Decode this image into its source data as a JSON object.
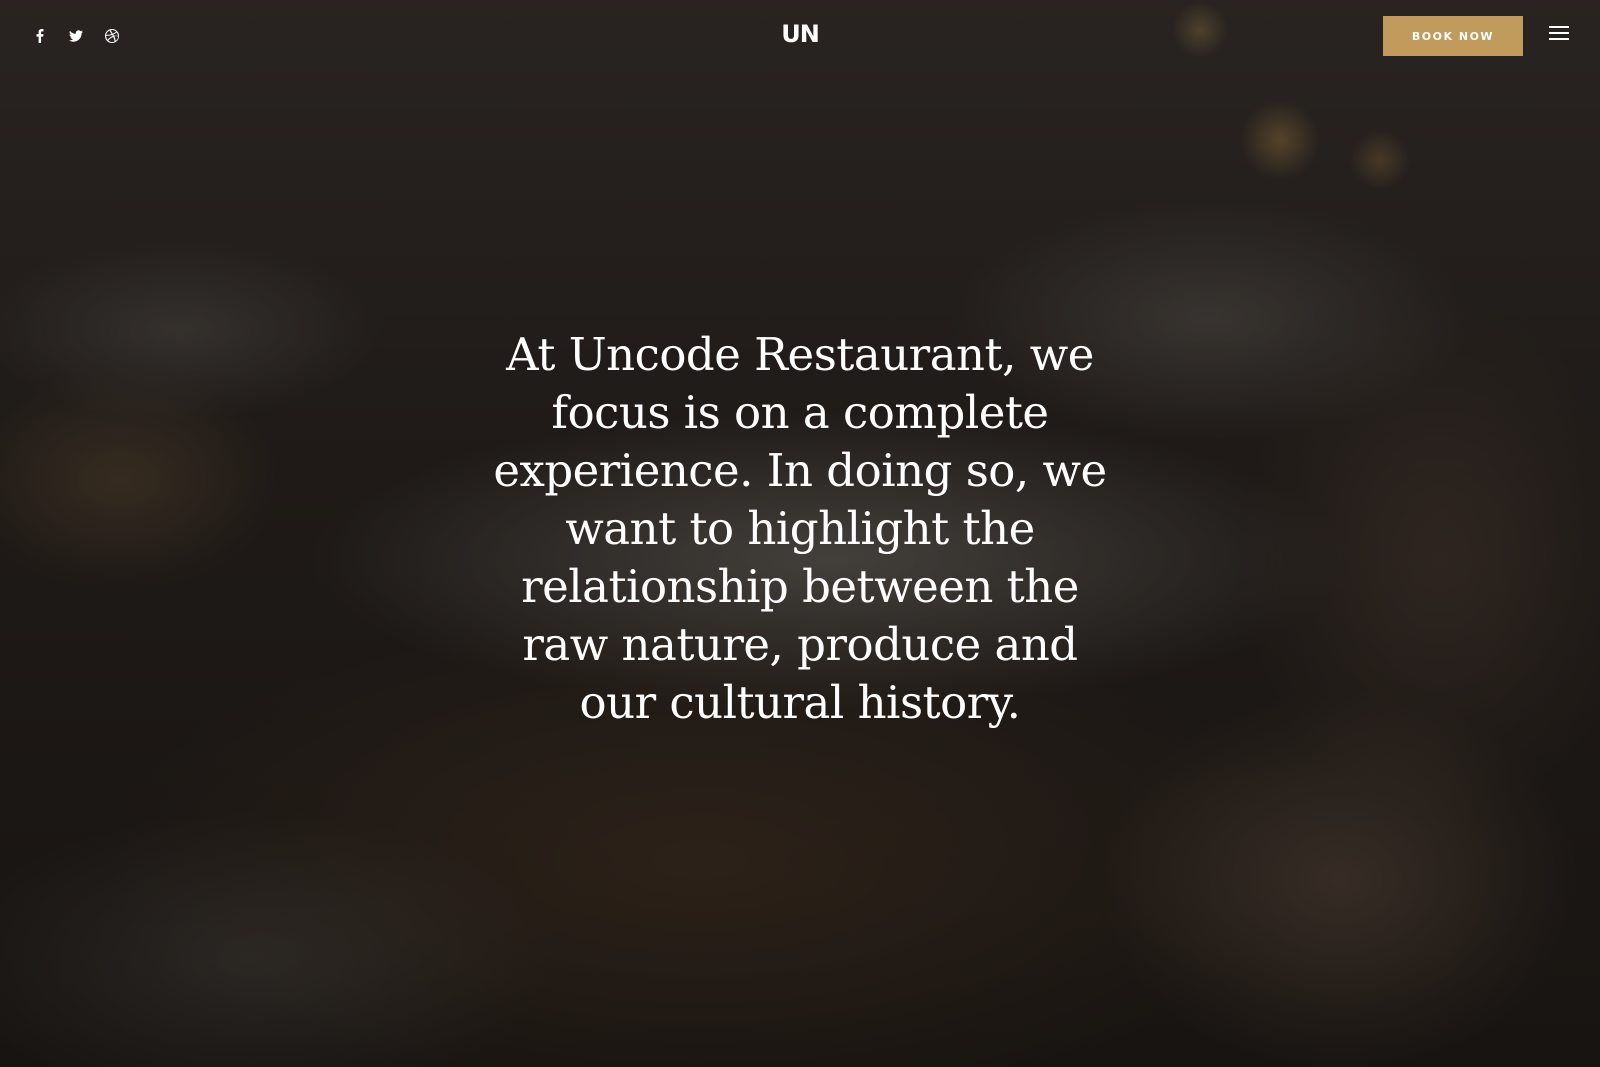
{
  "header": {
    "logo_text": "UN",
    "book_button_label": "BOOK NOW",
    "social_icons": [
      "facebook-icon",
      "twitter-icon",
      "dribbble-icon"
    ],
    "menu_icon": "hamburger-menu-icon"
  },
  "hero": {
    "intro_text": "At Uncode Restaurant, we focus is on a complete experience. In doing so, we want to highlight the relationship between the raw nature, produce and our cultural history."
  },
  "colors": {
    "accent": "#c19b5b",
    "text": "#ffffff"
  }
}
